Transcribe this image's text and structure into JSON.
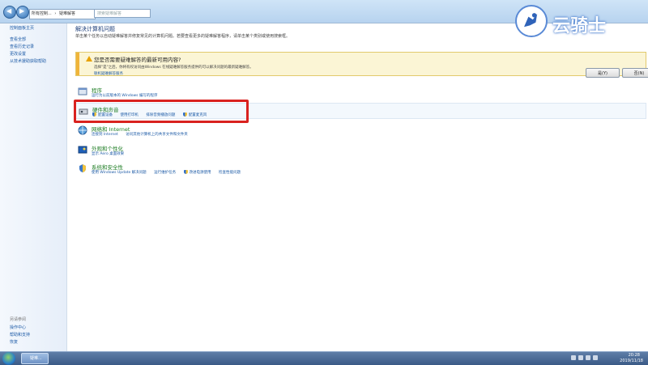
{
  "address_bar": {
    "segment1": "所有控制...",
    "segment2": "疑难解答"
  },
  "search": {
    "placeholder": "搜索疑难解答"
  },
  "sidebar": {
    "items": [
      {
        "label": "控制面板主页"
      },
      {
        "label": "查看全部"
      },
      {
        "label": "查看历史记录"
      },
      {
        "label": "更改设置"
      },
      {
        "label": "从技术援助获取帮助"
      }
    ],
    "see_also_title": "另请参阅",
    "footer_items": [
      {
        "label": "操作中心"
      },
      {
        "label": "帮助和支持"
      },
      {
        "label": "恢复"
      }
    ]
  },
  "main": {
    "title": "解决计算机问题",
    "description": "单击某个任务以自动疑难解答并修复常见的计算机问题。若要查看更多的疑难解答程序，请单击某个类别或使用搜索框。",
    "infobar": {
      "title": "您是否需要疑难解答的最新可用内容?",
      "desc": "选择\"是\"之后，你将有权访问由Windows 在线疑难解答服务提供的可以解决问题的最新疑难解答。",
      "link": "联机疑难解答服务",
      "yes_button": "是(Y)",
      "no_button": "否(N)"
    },
    "categories": [
      {
        "title": "程序",
        "links": [
          "运行为以前版本的 Windows 编写的程序"
        ]
      },
      {
        "title": "硬件和声音",
        "links": [
          "配置设备",
          "使用打印机",
          "排除音频播放问题",
          "配置麦克风"
        ]
      },
      {
        "title": "网络和 Internet",
        "links": [
          "连接到 Internet",
          "访问其他计算机上的共享文件和文件夹"
        ]
      },
      {
        "title": "外观和个性化",
        "links": [
          "显示 Aero 桌面效果"
        ]
      },
      {
        "title": "系统和安全性",
        "links": [
          "使用 Windows Update 解决问题",
          "运行维护任务",
          "改进电源使用",
          "检查性能问题"
        ]
      }
    ]
  },
  "watermark": {
    "text": "云骑士"
  },
  "taskbar": {
    "task_label": "疑难...",
    "time": "20:28",
    "date": "2019/11/18"
  },
  "colors": {
    "accent_link": "#1c5aa6",
    "category_title": "#1e7d24",
    "highlight_box": "#d9221f"
  }
}
